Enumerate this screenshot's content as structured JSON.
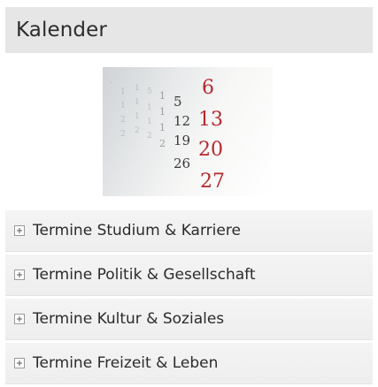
{
  "calendar": {
    "title": "Kalender",
    "image_icon": "calendar-photo",
    "image_numbers": [
      "6",
      "13",
      "20",
      "27"
    ]
  },
  "menu": {
    "items": [
      {
        "label": "Termine Studium & Karriere",
        "icon": "plus-box-icon"
      },
      {
        "label": "Termine Politik & Gesellschaft",
        "icon": "plus-box-icon"
      },
      {
        "label": "Termine Kultur & Soziales",
        "icon": "plus-box-icon"
      },
      {
        "label": "Termine Freizeit & Leben",
        "icon": "plus-box-icon"
      }
    ]
  },
  "colors": {
    "header_bg": "#e6e6e6",
    "item_bg": "#f1f1f1",
    "calendar_red": "#b3282d"
  }
}
